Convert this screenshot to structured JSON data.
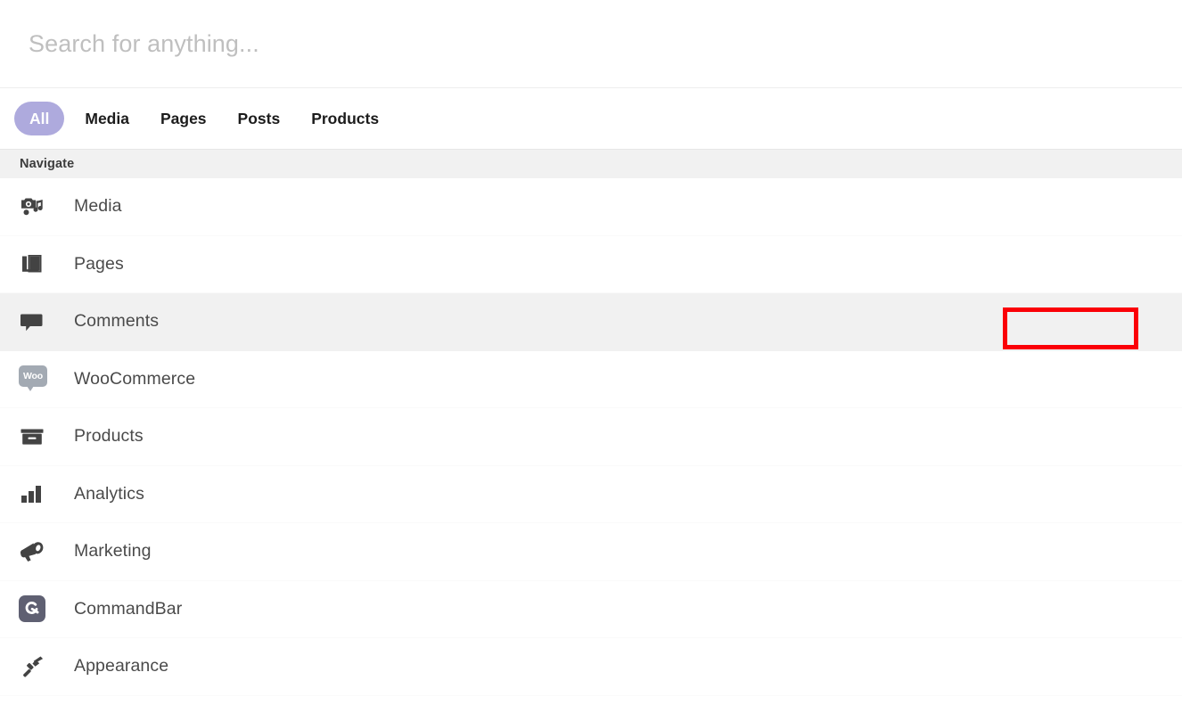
{
  "search": {
    "value": "",
    "placeholder": "Search for anything..."
  },
  "tabs": [
    {
      "label": "All",
      "active": true
    },
    {
      "label": "Media",
      "active": false
    },
    {
      "label": "Pages",
      "active": false
    },
    {
      "label": "Posts",
      "active": false
    },
    {
      "label": "Products",
      "active": false
    }
  ],
  "section": {
    "title": "Navigate"
  },
  "results": [
    {
      "label": "Media",
      "icon": "media-camera-note-icon",
      "highlighted": false
    },
    {
      "label": "Pages",
      "icon": "pages-stack-icon",
      "highlighted": false
    },
    {
      "label": "Comments",
      "icon": "comment-bubble-icon",
      "highlighted": true
    },
    {
      "label": "WooCommerce",
      "icon": "woocommerce-icon",
      "highlighted": false
    },
    {
      "label": "Products",
      "icon": "products-box-icon",
      "highlighted": false
    },
    {
      "label": "Analytics",
      "icon": "analytics-bars-icon",
      "highlighted": false
    },
    {
      "label": "Marketing",
      "icon": "marketing-megaphone-icon",
      "highlighted": false
    },
    {
      "label": "CommandBar",
      "icon": "commandbar-logo-icon",
      "highlighted": false
    },
    {
      "label": "Appearance",
      "icon": "appearance-brush-icon",
      "highlighted": false
    }
  ],
  "icons": {
    "woocommerce_text": "Woo"
  },
  "colors": {
    "accent_pill": "#aeaadd",
    "annotation": "#fb0007",
    "section_band": "#f1f1f1",
    "row_highlight": "#f1f1f1",
    "icon_dark": "#434343",
    "label_text": "#4a4a4a",
    "placeholder": "#bfbfbf"
  },
  "annotation": {
    "visible": true,
    "shape": "rectangle",
    "target_row": "Comments"
  }
}
